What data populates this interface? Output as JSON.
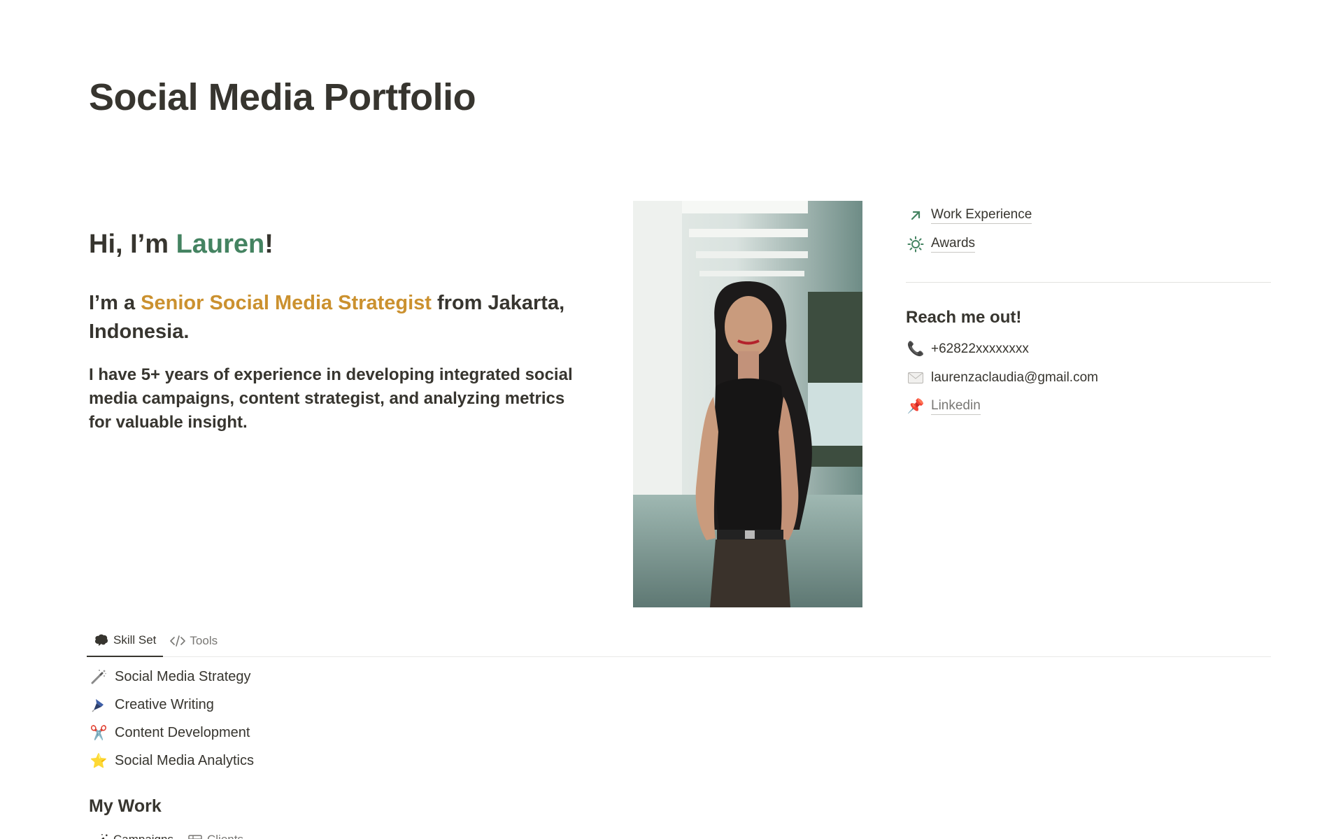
{
  "page": {
    "title": "Social Media Portfolio"
  },
  "intro": {
    "greeting_prefix": "Hi, I’m ",
    "greeting_name": "Lauren",
    "greeting_suffix": "!",
    "role_prefix": "I’m a ",
    "role_highlight": "Senior Social Media Strategist",
    "role_suffix": " from Jakarta, Indonesia.",
    "bio": "I have 5+ years of experience in developing integrated social media campaigns, content strategist, and analyzing metrics for valuable insight."
  },
  "links": [
    {
      "icon": "arrow-up-right-icon",
      "label": "Work Experience"
    },
    {
      "icon": "sun-icon",
      "label": "Awards"
    }
  ],
  "contact": {
    "title": "Reach me out!",
    "phone": "+62822xxxxxxxx",
    "email": "laurenzaclaudia@gmail.com",
    "linkedin": "Linkedin"
  },
  "skill_tabs": [
    {
      "icon": "brain-icon",
      "label": "Skill Set",
      "active": true
    },
    {
      "icon": "code-icon",
      "label": "Tools",
      "active": false
    }
  ],
  "skills": [
    {
      "icon": "magic-wand-icon",
      "label": "Social Media Strategy"
    },
    {
      "icon": "pen-icon",
      "label": "Creative Writing"
    },
    {
      "icon": "scissors-icon",
      "label": "Content Development"
    },
    {
      "icon": "star-icon",
      "label": "Social Media Analytics"
    }
  ],
  "my_work": {
    "title": "My Work",
    "tabs": [
      {
        "icon": "magic-wand-icon",
        "label": "Campaigns",
        "active": true
      },
      {
        "icon": "table-icon",
        "label": "Clients",
        "active": false
      }
    ]
  },
  "colors": {
    "name": "#448361",
    "highlight": "#cb912f",
    "text": "#37352f",
    "muted": "#787774"
  }
}
